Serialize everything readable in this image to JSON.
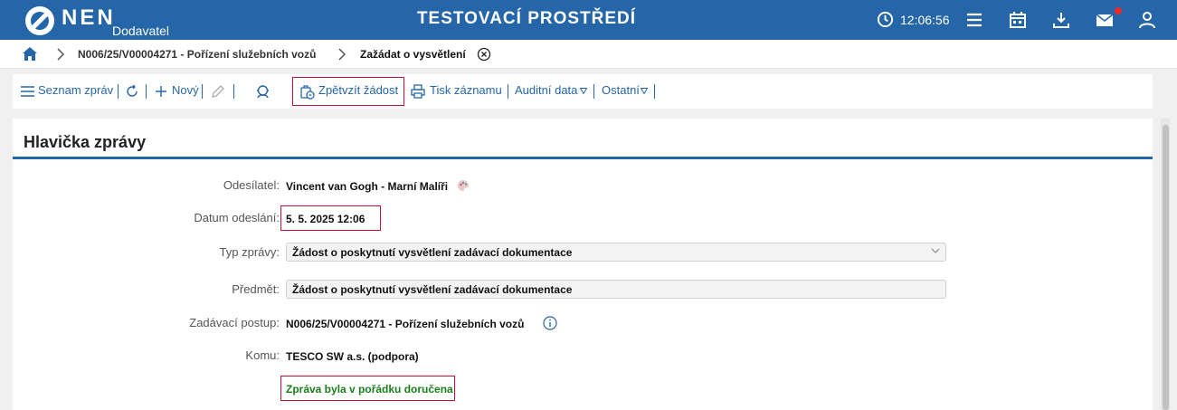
{
  "header": {
    "brand": "NEN",
    "brand_sub": "Dodavatel",
    "env_title": "TESTOVACÍ PROSTŘEDÍ",
    "time": "12:06:56",
    "icons": [
      "clock-icon",
      "menu-icon",
      "calendar-icon",
      "download-icon",
      "mail-icon",
      "user-icon"
    ],
    "accent": "#2566a8"
  },
  "breadcrumb": {
    "items": [
      "N006/25/V00004271 - Pořízení služebních vozů",
      "Zažádat o vysvětlení"
    ]
  },
  "toolbar": {
    "list_label": "Seznam zpráv",
    "new_label": "Nový",
    "withdraw_label": "Zpětvzít žádost",
    "print_label": "Tisk záznamu",
    "audit_label": "Auditní data",
    "other_label": "Ostatní"
  },
  "panel": {
    "title": "Hlavička zprávy",
    "sender_label": "Odesílatel:",
    "sender_value": "Vincent van Gogh - Marní Malíři",
    "date_label": "Datum odeslání:",
    "date_value": "5. 5. 2025 12:06",
    "type_label": "Typ zprávy:",
    "type_value": "Žádost o poskytnutí vysvětlení zadávací dokumentace",
    "subject_label": "Předmět:",
    "subject_value": "Žádost o poskytnutí vysvětlení zadávací dokumentace",
    "procedure_label": "Zadávací postup:",
    "procedure_value": "N006/25/V00004271 - Pořízení služebních vozů",
    "to_label": "Komu:",
    "to_value": "TESCO SW a.s. (podpora)",
    "status": "Zpráva byla v pořádku doručena",
    "status_color": "#1a7f1a",
    "highlight_color": "#c8102e"
  }
}
